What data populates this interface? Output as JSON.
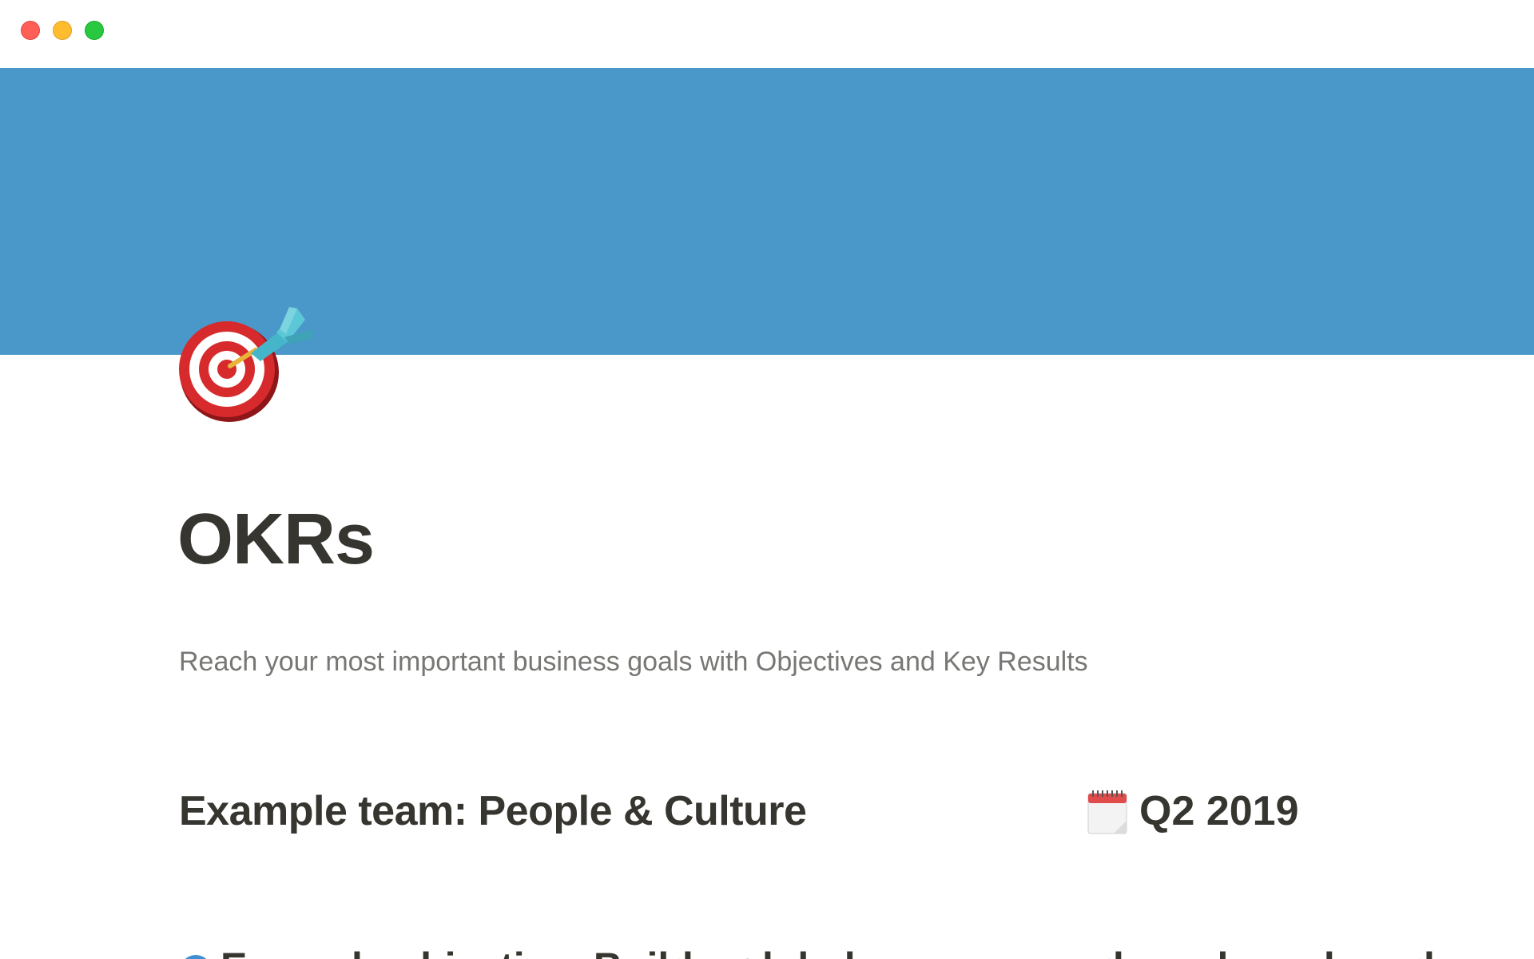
{
  "window": {
    "controls": [
      "close",
      "minimize",
      "zoom"
    ]
  },
  "colors": {
    "cover": "#4a98c9",
    "text": "#37352f",
    "muted_text": "#787774",
    "close": "#ff5f57",
    "minimize": "#febc2e",
    "zoom": "#28c840"
  },
  "page": {
    "icon": "dart-target-icon",
    "title": "OKRs",
    "subtitle": "Reach your most important business goals with Objectives and Key Results"
  },
  "team": {
    "heading": "Example team: People & Culture"
  },
  "quarter": {
    "icon": "calendar-icon",
    "label": "Q2 2019"
  },
  "objective": {
    "icon": "globe-icon",
    "label": "Example objective: Build a global company and employer brand"
  }
}
